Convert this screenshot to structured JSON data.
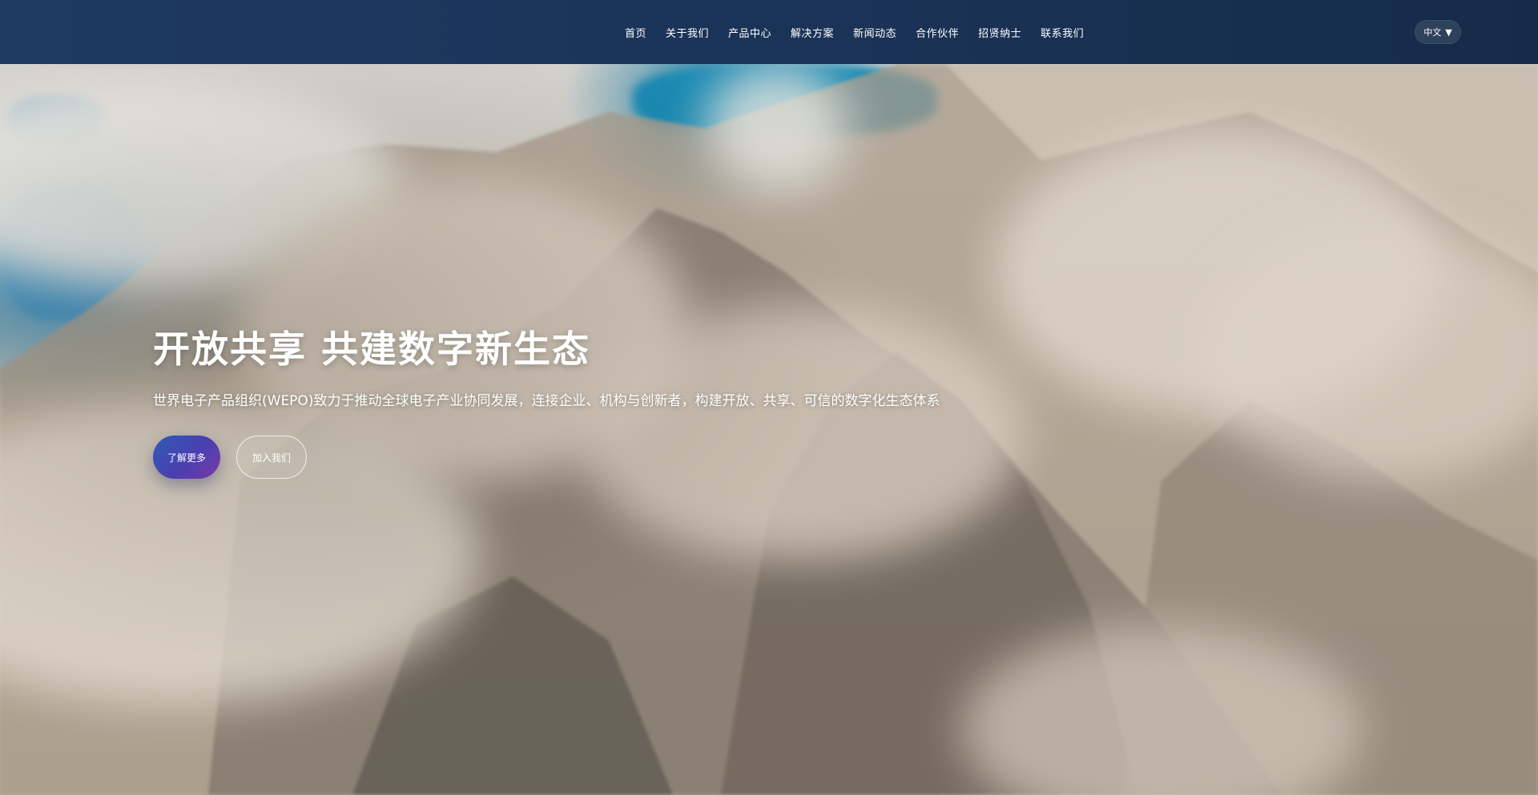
{
  "nav": {
    "items": [
      {
        "label": "首页"
      },
      {
        "label": "关于我们"
      },
      {
        "label": "产品中心"
      },
      {
        "label": "解决方案"
      },
      {
        "label": "新闻动态"
      },
      {
        "label": "合作伙伴"
      },
      {
        "label": "招贤纳士"
      },
      {
        "label": "联系我们"
      }
    ],
    "language": {
      "label": "中文",
      "caret": "▼"
    }
  },
  "hero": {
    "title": "开放共享 共建数字新生态",
    "description": "世界电子产品组织(WEPO)致力于推动全球电子产业协同发展，连接企业、机构与创新者，构建开放、共享、可信的数字化生态体系",
    "primary_button": "了解更多",
    "secondary_button": "加入我们"
  },
  "colors": {
    "header_bg": "#1b3556",
    "primary_gradient_start": "#2f5bb4",
    "primary_gradient_end": "#7a3aa8",
    "text": "#ffffff"
  }
}
